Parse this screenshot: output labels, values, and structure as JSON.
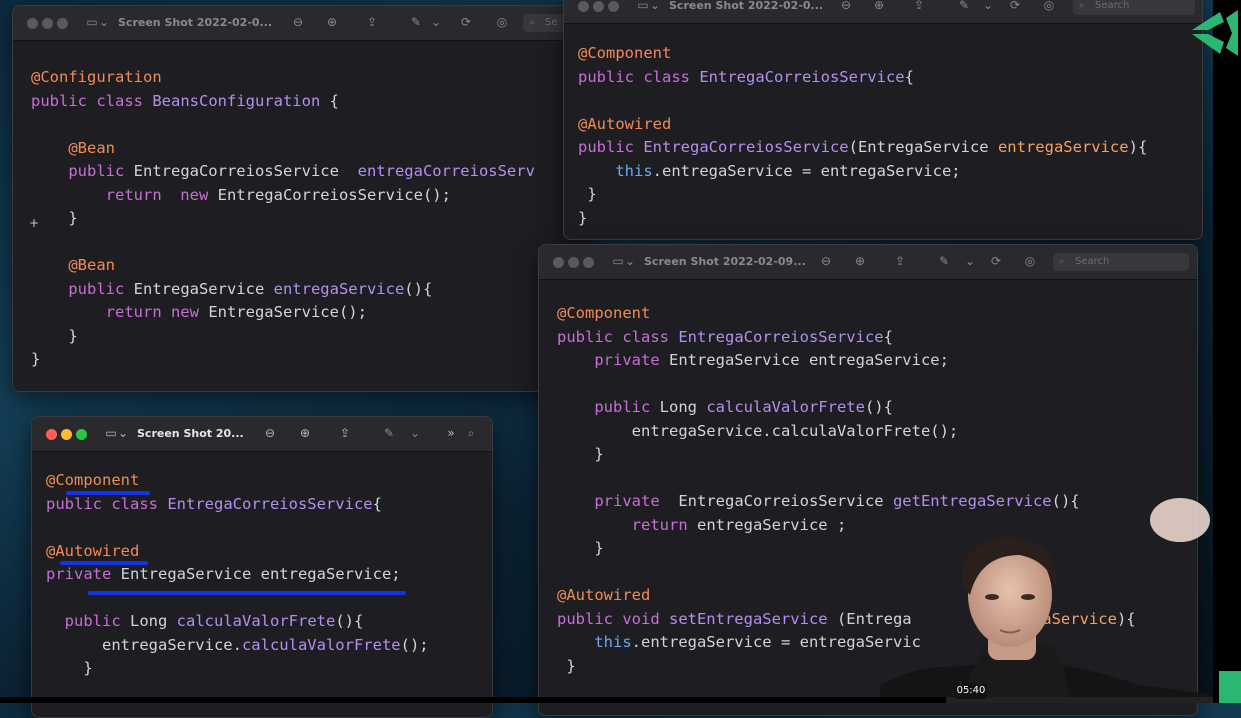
{
  "player": {
    "timestamp": "05:40",
    "progress_fraction": 0.78
  },
  "window_tl": {
    "title": "Screen Shot 2022-02-0...",
    "search_placeholder": "Se",
    "code": [
      [
        [
          "ann",
          "@Configuration"
        ]
      ],
      [
        [
          "kw",
          "public class "
        ],
        [
          "cls",
          "BeansConfiguration"
        ],
        [
          "txt",
          " {"
        ]
      ],
      [],
      [
        [
          "txt",
          "    "
        ],
        [
          "ann",
          "@Bean"
        ]
      ],
      [
        [
          "txt",
          "    "
        ],
        [
          "kw",
          "public "
        ],
        [
          "txt",
          "EntregaCorreiosService  "
        ],
        [
          "fn",
          "entregaCorreiosServ"
        ]
      ],
      [
        [
          "txt",
          "        "
        ],
        [
          "kw",
          "return  new "
        ],
        [
          "txt",
          "EntregaCorreiosService();"
        ]
      ],
      [
        [
          "txt",
          "    }"
        ]
      ],
      [],
      [
        [
          "txt",
          "    "
        ],
        [
          "ann",
          "@Bean"
        ]
      ],
      [
        [
          "txt",
          "    "
        ],
        [
          "kw",
          "public "
        ],
        [
          "txt",
          "EntregaService "
        ],
        [
          "fn",
          "entregaService"
        ],
        [
          "txt",
          "(){"
        ]
      ],
      [
        [
          "txt",
          "        "
        ],
        [
          "kw",
          "return new "
        ],
        [
          "txt",
          "EntregaService();"
        ]
      ],
      [
        [
          "txt",
          "    }"
        ]
      ],
      [
        [
          "txt",
          "}"
        ]
      ]
    ]
  },
  "window_tr": {
    "title": "Screen Shot 2022-02-0...",
    "search_placeholder": "Search",
    "code": [
      [
        [
          "ann",
          "@Component"
        ]
      ],
      [
        [
          "kw",
          "public class "
        ],
        [
          "cls",
          "EntregaCorreiosService"
        ],
        [
          "txt",
          "{"
        ]
      ],
      [],
      [
        [
          "ann",
          "@Autowired"
        ]
      ],
      [
        [
          "kw",
          "public "
        ],
        [
          "fn",
          "EntregaCorreiosService"
        ],
        [
          "txt",
          "(EntregaService "
        ],
        [
          "prm",
          "entregaService"
        ],
        [
          "txt",
          "){"
        ]
      ],
      [
        [
          "txt",
          "    "
        ],
        [
          "ths",
          "this"
        ],
        [
          "txt",
          ".entregaService = entregaService;"
        ]
      ],
      [
        [
          "txt",
          " }"
        ]
      ],
      [
        [
          "txt",
          "}"
        ]
      ]
    ]
  },
  "window_bl": {
    "title": "Screen Shot 20...",
    "code": [
      [
        [
          "ann",
          "@Component"
        ]
      ],
      [
        [
          "kw",
          "public class "
        ],
        [
          "cls",
          "EntregaCorreiosService"
        ],
        [
          "txt",
          "{"
        ]
      ],
      [],
      [
        [
          "ann",
          "@Autowired"
        ]
      ],
      [
        [
          "kw",
          "private "
        ],
        [
          "txt",
          "EntregaService entregaService;"
        ]
      ],
      [],
      [
        [
          "txt",
          "  "
        ],
        [
          "kw",
          "public "
        ],
        [
          "txt",
          "Long "
        ],
        [
          "fn",
          "calculaValorFrete"
        ],
        [
          "txt",
          "(){"
        ]
      ],
      [
        [
          "txt",
          "      entregaService."
        ],
        [
          "fn",
          "calculaValorFrete"
        ],
        [
          "txt",
          "();"
        ]
      ],
      [
        [
          "txt",
          "    }"
        ]
      ]
    ]
  },
  "window_br": {
    "title": "Screen Shot 2022-02-09...",
    "search_placeholder": "Search",
    "code": [
      [
        [
          "ann",
          "@Component"
        ]
      ],
      [
        [
          "kw",
          "public class "
        ],
        [
          "cls",
          "EntregaCorreiosService"
        ],
        [
          "txt",
          "{"
        ]
      ],
      [
        [
          "txt",
          "    "
        ],
        [
          "kw",
          "private "
        ],
        [
          "txt",
          "EntregaService entregaService;"
        ]
      ],
      [],
      [
        [
          "txt",
          "    "
        ],
        [
          "kw",
          "public "
        ],
        [
          "txt",
          "Long "
        ],
        [
          "fn",
          "calculaValorFrete"
        ],
        [
          "txt",
          "(){"
        ]
      ],
      [
        [
          "txt",
          "        entregaService.calculaValorFrete();"
        ]
      ],
      [
        [
          "txt",
          "    }"
        ]
      ],
      [],
      [
        [
          "txt",
          "    "
        ],
        [
          "kw",
          "private  "
        ],
        [
          "txt",
          "EntregaCorreiosService "
        ],
        [
          "fn",
          "getEntregaService"
        ],
        [
          "txt",
          "(){"
        ]
      ],
      [
        [
          "txt",
          "        "
        ],
        [
          "kw",
          "return "
        ],
        [
          "txt",
          "entregaService ;"
        ]
      ],
      [
        [
          "txt",
          "    }"
        ]
      ],
      [],
      [
        [
          "ann",
          "@Autowired"
        ]
      ],
      [
        [
          "kw",
          "public void "
        ],
        [
          "fn",
          "setEntregaService"
        ],
        [
          "txt",
          " (Entrega"
        ],
        [
          "txt",
          "        "
        ],
        [
          "prm",
          "entregaService"
        ],
        [
          "txt",
          "){"
        ]
      ],
      [
        [
          "txt",
          "    "
        ],
        [
          "ths",
          "this"
        ],
        [
          "txt",
          ".entregaService = entregaServic"
        ]
      ],
      [
        [
          "txt",
          " }"
        ]
      ]
    ]
  }
}
